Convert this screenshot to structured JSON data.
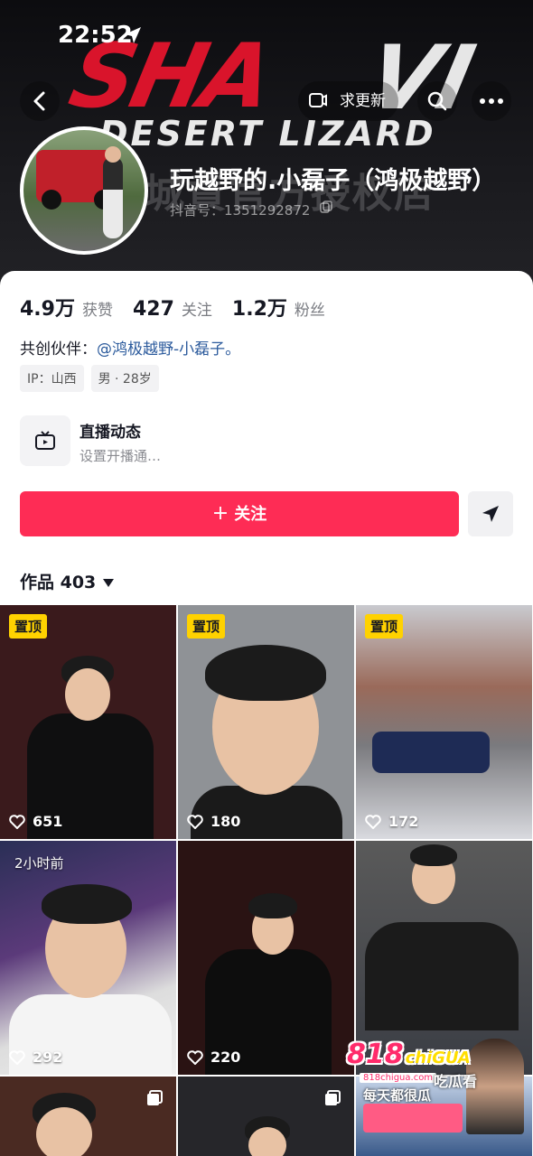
{
  "status_bar": {
    "time": "22:52"
  },
  "banner": {
    "brand_main": "SHA",
    "brand_mark": "VI",
    "brand_sub": "DESERT LIZARD",
    "watermark": "城賁官方授权店"
  },
  "nav": {
    "update_label": "求更新"
  },
  "profile": {
    "name": "玩越野的.小磊子（鸿极越野）",
    "douyin_id": "抖音号：1351292872"
  },
  "stats": [
    {
      "value": "4.9万",
      "label": "获赞"
    },
    {
      "value": "427",
      "label": "关注"
    },
    {
      "value": "1.2万",
      "label": "粉丝"
    }
  ],
  "partner": {
    "prefix": "共创伙伴：",
    "link": "@鸿极越野-小磊子。"
  },
  "tags": [
    "IP：山西",
    "男 · 28岁"
  ],
  "live": {
    "title": "直播动态",
    "subtitle": "设置开播通…"
  },
  "follow": {
    "plus": "+",
    "label": "关注"
  },
  "works": {
    "label": "作品 403"
  },
  "tiles": [
    {
      "badge": "置顶",
      "likes": "651",
      "bg": "#3a1a1c"
    },
    {
      "badge": "置顶",
      "likes": "180",
      "bg": "#8f9296"
    },
    {
      "badge": "置顶",
      "likes": "172",
      "bg": "#c9cacf"
    },
    {
      "time": "2小时前",
      "likes": "292",
      "bg": "#2a2f56"
    },
    {
      "likes": "220",
      "bg": "#2a1313"
    },
    {
      "likes": "",
      "bg": "#3a3d44"
    },
    {
      "likes": "",
      "bg": "#4a2a22"
    },
    {
      "likes": "",
      "bg": "#26262a"
    },
    {
      "likes": "",
      "bg": "#3a5a8a"
    }
  ],
  "ad": {
    "logo": "818",
    "logo_en": "chiGUA",
    "url": "818chigua.com",
    "headline": "每天都很瓜",
    "overlay_text": "吃瓜看"
  }
}
